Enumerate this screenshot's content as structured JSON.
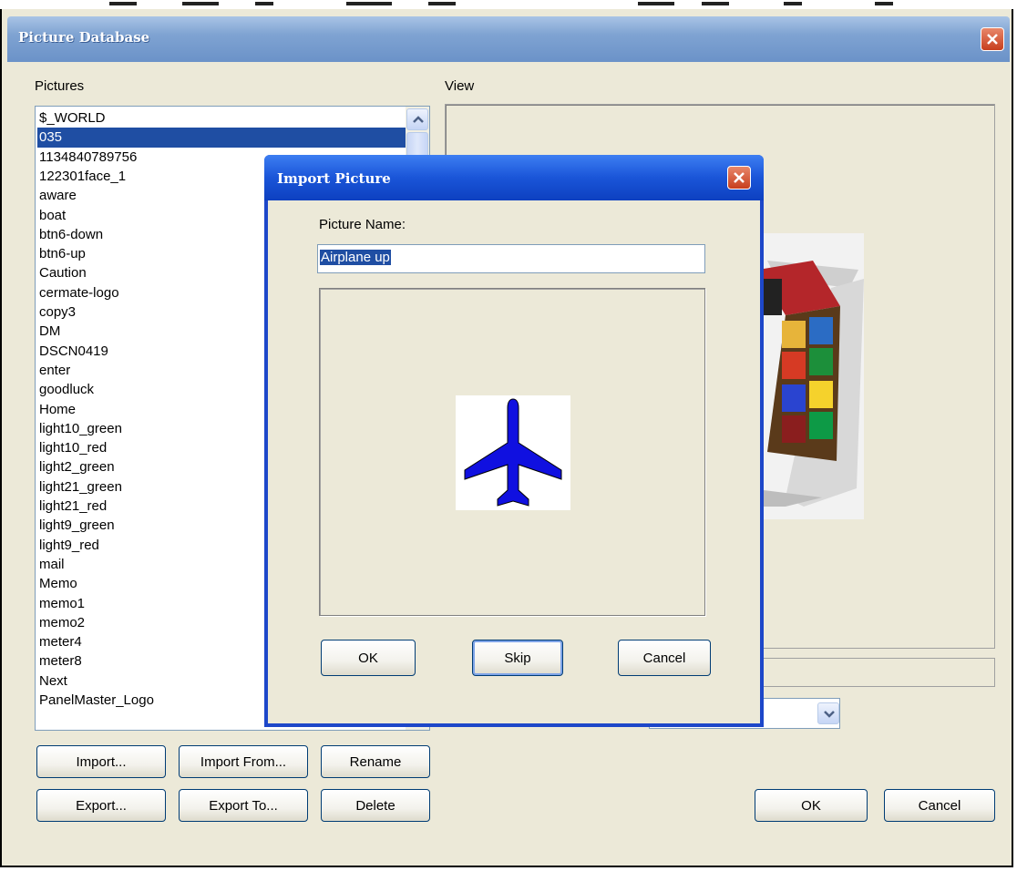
{
  "window": {
    "title": "Picture Database"
  },
  "pictures": {
    "label": "Pictures",
    "selected_index": 1,
    "items": [
      "$_WORLD",
      "035",
      "1134840789756",
      "122301face_1",
      "aware",
      "boat",
      "btn6-down",
      "btn6-up",
      "Caution",
      "cermate-logo",
      "copy3",
      "DM",
      "DSCN0419",
      "enter",
      "goodluck",
      "Home",
      "light10_green",
      "light10_red",
      "light2_green",
      "light21_green",
      "light21_red",
      "light9_green",
      "light9_red",
      "mail",
      "Memo",
      "memo1",
      "memo2",
      "meter4",
      "meter8",
      "Next",
      "PanelMaster_Logo"
    ]
  },
  "view": {
    "label": "View"
  },
  "buttons": {
    "import": "Import...",
    "import_from": "Import From...",
    "rename": "Rename",
    "export": "Export...",
    "export_to": "Export To...",
    "delete": "Delete",
    "ok": "OK",
    "cancel": "Cancel"
  },
  "dialog": {
    "title": "Import Picture",
    "name_label": "Picture Name:",
    "name_value": "Airplane up",
    "ok": "OK",
    "skip": "Skip",
    "cancel": "Cancel"
  },
  "colors": {
    "selection": "#1f4ea3",
    "dialog_title": "#1a55d8",
    "plane": "#1010e0"
  }
}
